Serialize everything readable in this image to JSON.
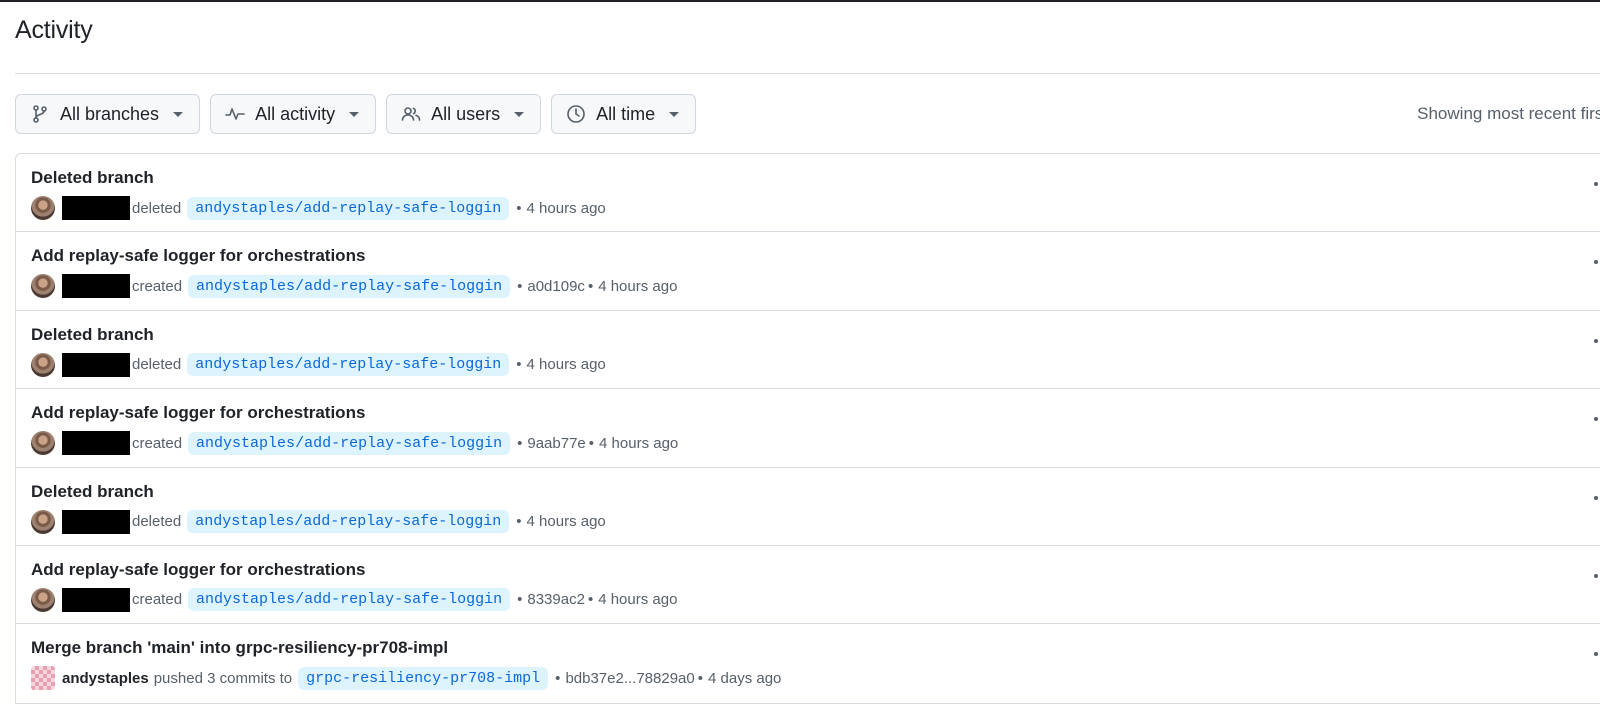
{
  "page": {
    "title": "Activity",
    "showing_note": "Showing most recent first"
  },
  "filters": [
    {
      "label": "All branches",
      "icon": "branch-icon"
    },
    {
      "label": "All activity",
      "icon": "pulse-icon"
    },
    {
      "label": "All users",
      "icon": "people-icon"
    },
    {
      "label": "All time",
      "icon": "clock-icon"
    }
  ],
  "activities": [
    {
      "title": "Deleted branch",
      "user": "",
      "verb": "deleted",
      "branch": "andystaples/add-replay-safe-loggin",
      "commit": "",
      "time": "4 hours ago"
    },
    {
      "title": "Add replay-safe logger for orchestrations",
      "user": "",
      "verb": "created",
      "branch": "andystaples/add-replay-safe-loggin",
      "commit": "a0d109c",
      "time": "4 hours ago"
    },
    {
      "title": "Deleted branch",
      "user": "",
      "verb": "deleted",
      "branch": "andystaples/add-replay-safe-loggin",
      "commit": "",
      "time": "4 hours ago"
    },
    {
      "title": "Add replay-safe logger for orchestrations",
      "user": "",
      "verb": "created",
      "branch": "andystaples/add-replay-safe-loggin",
      "commit": "9aab77e",
      "time": "4 hours ago"
    },
    {
      "title": "Deleted branch",
      "user": "",
      "verb": "deleted",
      "branch": "andystaples/add-replay-safe-loggin",
      "commit": "",
      "time": "4 hours ago"
    },
    {
      "title": "Add replay-safe logger for orchestrations",
      "user": "",
      "verb": "created",
      "branch": "andystaples/add-replay-safe-loggin",
      "commit": "8339ac2",
      "time": "4 hours ago"
    },
    {
      "title": "Merge branch 'main' into grpc-resiliency-pr708-impl",
      "user": "andystaples",
      "verb": "pushed 3 commits to",
      "branch": "grpc-resiliency-pr708-impl",
      "commit": "bdb37e2...78829a0",
      "time": "4 days ago"
    }
  ],
  "colors": {
    "accent": "#0969da",
    "branch_bg": "#ddf4ff",
    "muted_text": "#57606a",
    "border": "#d8dee4"
  }
}
